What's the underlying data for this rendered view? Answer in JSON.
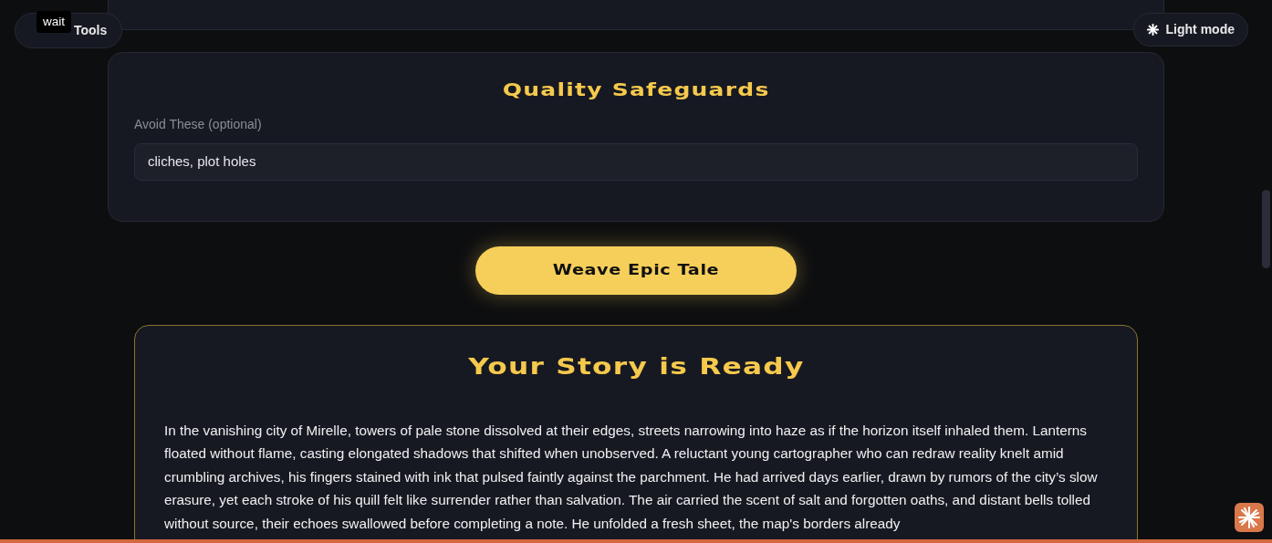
{
  "back_button": {
    "label": "Tools"
  },
  "tooltip": {
    "text": "wait"
  },
  "theme_toggle": {
    "label": "Light mode"
  },
  "safeguards": {
    "title": "Quality Safeguards",
    "field": {
      "label": "Avoid These (optional)",
      "value": "cliches, plot holes"
    }
  },
  "submit_button": {
    "label": "Weave Epic Tale"
  },
  "result": {
    "title": "Your Story is Ready",
    "story": "In the vanishing city of Mirelle, towers of pale stone dissolved at their edges, streets narrowing into haze as if the horizon itself inhaled them. Lanterns floated without flame, casting elongated shadows that shifted when unobserved. A reluctant young cartographer who can redraw reality knelt amid crumbling archives, his fingers stained with ink that pulsed faintly against the parchment. He had arrived days earlier, drawn by rumors of the city’s slow erasure, yet each stroke of his quill felt like surrender rather than salvation. The air carried the scent of salt and forgotten oaths, and distant bells tolled without source, their echoes swallowed before completing a note. He unfolded a fresh sheet, the map's borders already"
  }
}
